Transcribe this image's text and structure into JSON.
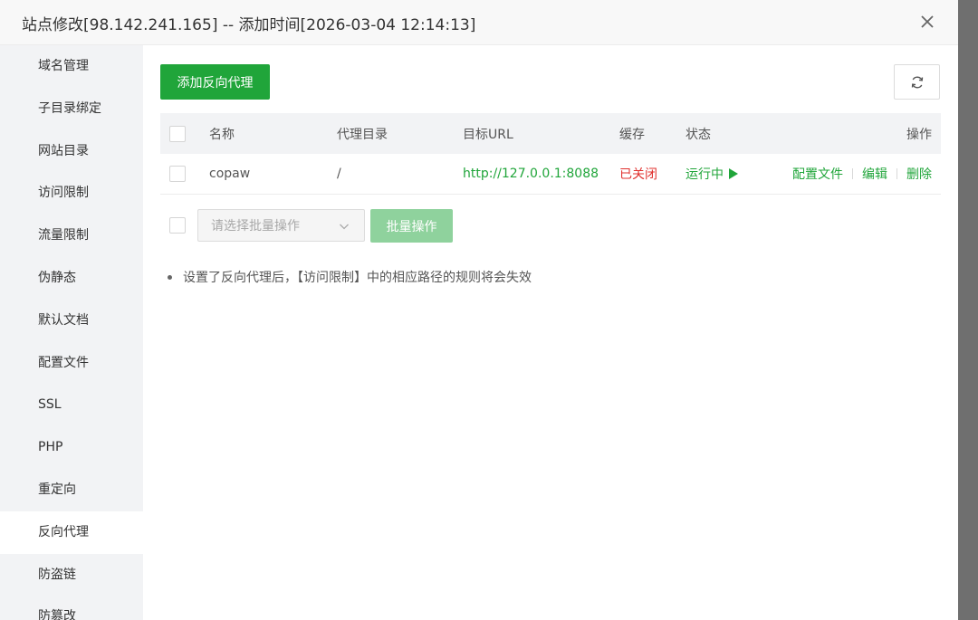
{
  "dialog": {
    "title": "站点修改[98.142.241.165] -- 添加时间[2026-03-04 12:14:13]"
  },
  "sidebar": {
    "items": [
      {
        "label": "域名管理"
      },
      {
        "label": "子目录绑定"
      },
      {
        "label": "网站目录"
      },
      {
        "label": "访问限制"
      },
      {
        "label": "流量限制"
      },
      {
        "label": "伪静态"
      },
      {
        "label": "默认文档"
      },
      {
        "label": "配置文件"
      },
      {
        "label": "SSL"
      },
      {
        "label": "PHP"
      },
      {
        "label": "重定向"
      },
      {
        "label": "反向代理",
        "active": true
      },
      {
        "label": "防盗链"
      },
      {
        "label": "防篡改"
      }
    ]
  },
  "toolbar": {
    "add_label": "添加反向代理",
    "refresh_icon": "refresh-icon"
  },
  "table": {
    "headers": {
      "name": "名称",
      "dir": "代理目录",
      "url": "目标URL",
      "cache": "缓存",
      "status": "状态",
      "ops": "操作"
    },
    "rows": [
      {
        "name": "copaw",
        "dir": "/",
        "url": "http://127.0.0.1:8088",
        "cache": "已关闭",
        "status": "运行中",
        "ops": [
          "配置文件",
          "编辑",
          "删除"
        ]
      }
    ]
  },
  "batch": {
    "placeholder": "请选择批量操作",
    "button": "批量操作"
  },
  "tips": {
    "text": "设置了反向代理后，【访问限制】中的相应路径的规则将会失效"
  },
  "colors": {
    "accent": "#20a53a",
    "danger": "#e0302d",
    "disabled_accent": "#8fd29d"
  }
}
